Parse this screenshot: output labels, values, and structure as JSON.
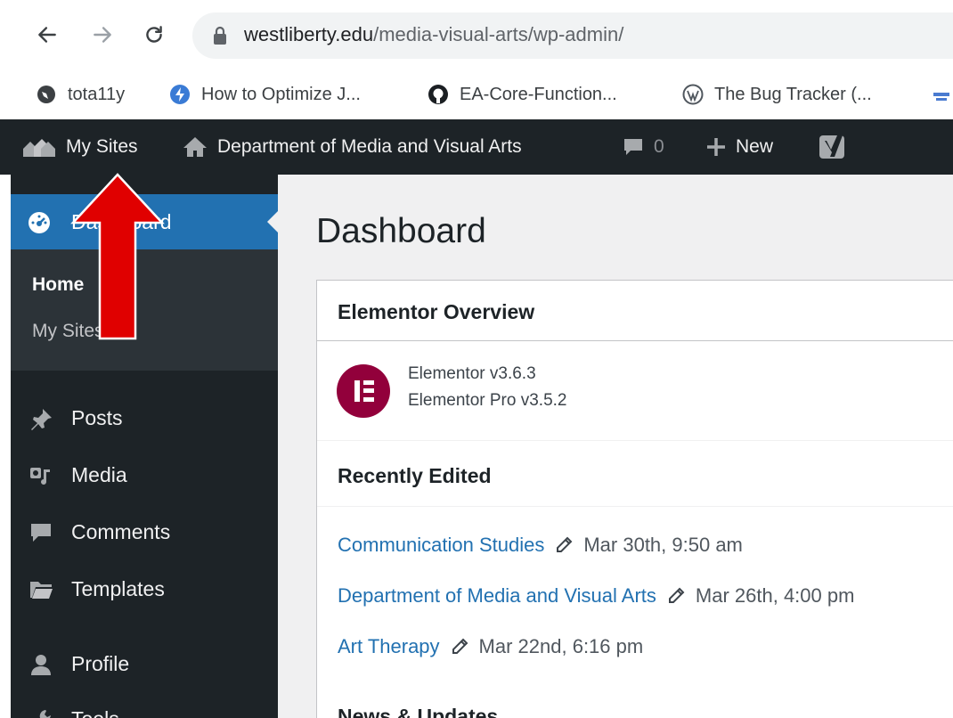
{
  "browser": {
    "url_host": "westliberty.edu",
    "url_path": "/media-visual-arts/wp-admin/",
    "bookmarks": [
      {
        "label": "tota11y",
        "icon": "globe-icon"
      },
      {
        "label": "How to Optimize J...",
        "icon": "bookmark-favicon-icon"
      },
      {
        "label": "EA-Core-Function...",
        "icon": "github-icon"
      },
      {
        "label": "The Bug Tracker (...",
        "icon": "wordpress-icon"
      }
    ]
  },
  "adminbar": {
    "my_sites": "My Sites",
    "site_name": "Department of Media and Visual Arts",
    "comments_count": "0",
    "new_label": "New"
  },
  "sidebar": {
    "dashboard": "Dashboard",
    "submenu": [
      "Home",
      "My Sites"
    ],
    "items": [
      "Posts",
      "Media",
      "Comments",
      "Templates",
      "Profile",
      "Tools"
    ]
  },
  "main": {
    "title": "Dashboard",
    "panel_title": "Elementor Overview",
    "versions": [
      "Elementor v3.6.3",
      "Elementor Pro v3.5.2"
    ],
    "recently_edited_title": "Recently Edited",
    "recent": [
      {
        "title": "Communication Studies",
        "date": "Mar 30th, 9:50 am"
      },
      {
        "title": "Department of Media and Visual Arts",
        "date": "Mar 26th, 4:00 pm"
      },
      {
        "title": "Art Therapy",
        "date": "Mar 22nd, 6:16 pm"
      }
    ],
    "news_title": "News & Updates"
  },
  "colors": {
    "wp_dark": "#1d2327",
    "wp_blue": "#2271b1",
    "elementor": "#92003b",
    "annotation_arrow": "#e00000"
  }
}
